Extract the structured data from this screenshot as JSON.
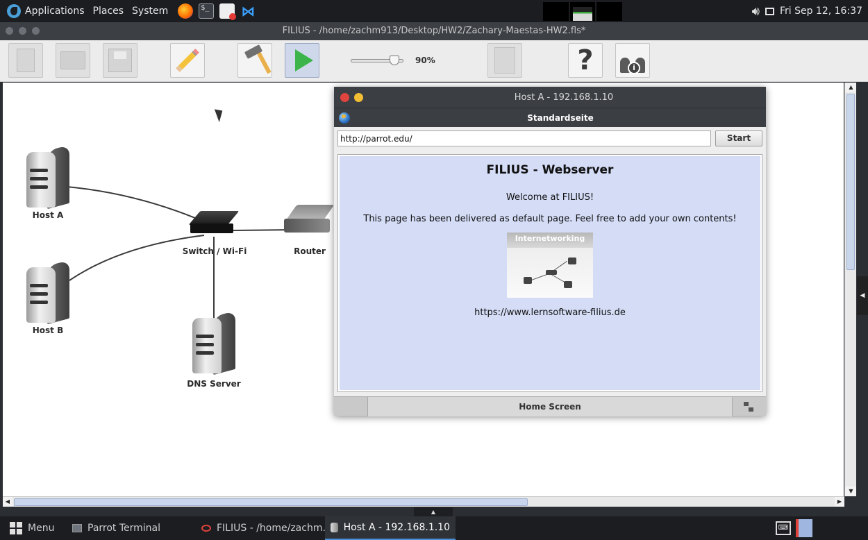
{
  "top_panel": {
    "menus": [
      "Applications",
      "Places",
      "System"
    ],
    "clock": "Fri Sep 12, 16:37"
  },
  "main_window": {
    "title": "FILIUS - /home/zachm913/Desktop/HW2/Zachary-Maestas-HW2.fls*"
  },
  "toolbar": {
    "zoom_label": "90%",
    "zoom_level_percent": 90,
    "buttons": [
      "new-file",
      "open-file",
      "save-file",
      "design-mode",
      "hammer",
      "simulation-mode",
      "documentation",
      "help",
      "about"
    ]
  },
  "network": {
    "nodes": {
      "host_a": "Host A",
      "host_b": "Host B",
      "switch": "Switch / Wi-Fi",
      "router": "Router",
      "dns_server": "DNS Server"
    }
  },
  "browser": {
    "title": "Host A - 192.168.1.10",
    "subtitle": "Standardseite",
    "url": "http://parrot.edu/",
    "start_label": "Start",
    "page": {
      "heading": "FILIUS - Webserver",
      "welcome": "Welcome at FILIUS!",
      "body": "This page has been delivered as default page. Feel free to add your own contents!",
      "image_caption": "Internetworking",
      "link": "https://www.lernsoftware-filius.de"
    },
    "bottom_tab": "Home Screen",
    "colors": {
      "close": "#e0443e",
      "minimize": "#f2be33",
      "page_bg": "#d4dcf6"
    }
  },
  "taskbar": {
    "menu_label": "Menu",
    "tasks": [
      {
        "label": "Parrot Terminal"
      },
      {
        "label": "FILIUS - /home/zachm..."
      },
      {
        "label": "Host A - 192.168.1.10"
      }
    ]
  }
}
